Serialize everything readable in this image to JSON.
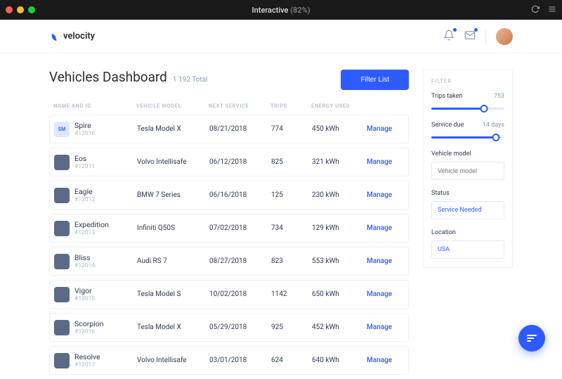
{
  "titlebar": {
    "title": "Interactive",
    "pct": "(82%)"
  },
  "header": {
    "brand": "velocity"
  },
  "page": {
    "title": "Vehicles Dashboard",
    "total": "1 192 Total",
    "filter_btn": "Filter List"
  },
  "columns": {
    "name": "NAME AND ID",
    "model": "VEHICLE MODEL",
    "service": "NEXT SERVICE",
    "trips": "TRIPS",
    "energy": "ENERGY USED",
    "action": ""
  },
  "vehicles": [
    {
      "thumb": "SM",
      "name": "Spire",
      "id": "#12010",
      "model": "Tesla Model X",
      "next_service": "08/21/2018",
      "trips": "774",
      "energy": "450 kWh",
      "action": "Manage"
    },
    {
      "thumb": "",
      "name": "Eos",
      "id": "#12011",
      "model": "Volvo Intellisafe",
      "next_service": "06/12/2018",
      "trips": "825",
      "energy": "321 kWh",
      "action": "Manage"
    },
    {
      "thumb": "",
      "name": "Eagle",
      "id": "#12012",
      "model": "BMW 7 Series",
      "next_service": "06/16/2018",
      "trips": "125",
      "energy": "230 kWh",
      "action": "Manage"
    },
    {
      "thumb": "",
      "name": "Expedition",
      "id": "#12013",
      "model": "Infiniti Q50S",
      "next_service": "07/02/2018",
      "trips": "734",
      "energy": "129 kWh",
      "action": "Manage"
    },
    {
      "thumb": "",
      "name": "Bliss",
      "id": "#12014",
      "model": "Audi RS 7",
      "next_service": "08/27/2018",
      "trips": "823",
      "energy": "553 kWh",
      "action": "Manage"
    },
    {
      "thumb": "",
      "name": "Vigor",
      "id": "#12015",
      "model": "Tesla Model S",
      "next_service": "10/02/2018",
      "trips": "1142",
      "energy": "650 kWh",
      "action": "Manage"
    },
    {
      "thumb": "",
      "name": "Scorpion",
      "id": "#12016",
      "model": "Tesla Model X",
      "next_service": "05/29/2018",
      "trips": "925",
      "energy": "452 kWh",
      "action": "Manage"
    },
    {
      "thumb": "",
      "name": "Resolve",
      "id": "#12017",
      "model": "Volvo Intellisafe",
      "next_service": "03/01/2018",
      "trips": "624",
      "energy": "640 kWh",
      "action": "Manage"
    }
  ],
  "filter": {
    "title": "FILTER",
    "trips": {
      "label": "Trips taken",
      "value": "753",
      "pct": 72
    },
    "service": {
      "label": "Service due",
      "value": "14 days",
      "pct": 88
    },
    "model": {
      "label": "Vehicle model",
      "placeholder": "Vehicle model"
    },
    "status": {
      "label": "Status",
      "value": "Service Needed"
    },
    "location": {
      "label": "Location",
      "value": "USA"
    }
  }
}
